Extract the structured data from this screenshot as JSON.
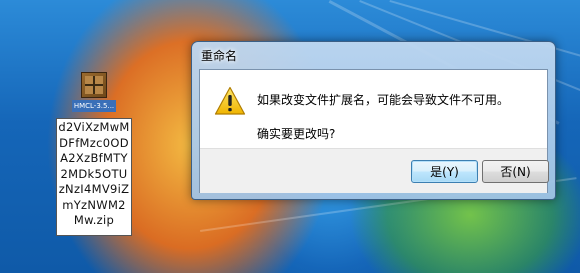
{
  "desktop": {
    "file_icon": {
      "name": "minecraft-launcher-icon",
      "caption": "HMCL-3.5...",
      "rename_lines": [
        "d2ViXzMwM",
        "DFfMzc0OD",
        "A2XzBfMTY",
        "2MDk5OTU",
        "zNzI4MV9iZ",
        "mYzNWM2",
        "Mw.zip"
      ]
    }
  },
  "dialog": {
    "title": "重命名",
    "icon": "warning-icon",
    "message": "如果改变文件扩展名，可能会导致文件不可用。",
    "question": "确实要更改吗?",
    "buttons": {
      "yes": "是(Y)",
      "no": "否(N)"
    }
  },
  "colors": {
    "warning_yellow": "#f5c518",
    "dialog_frame": "#a0c3e6",
    "default_button": "#bee6fd"
  }
}
